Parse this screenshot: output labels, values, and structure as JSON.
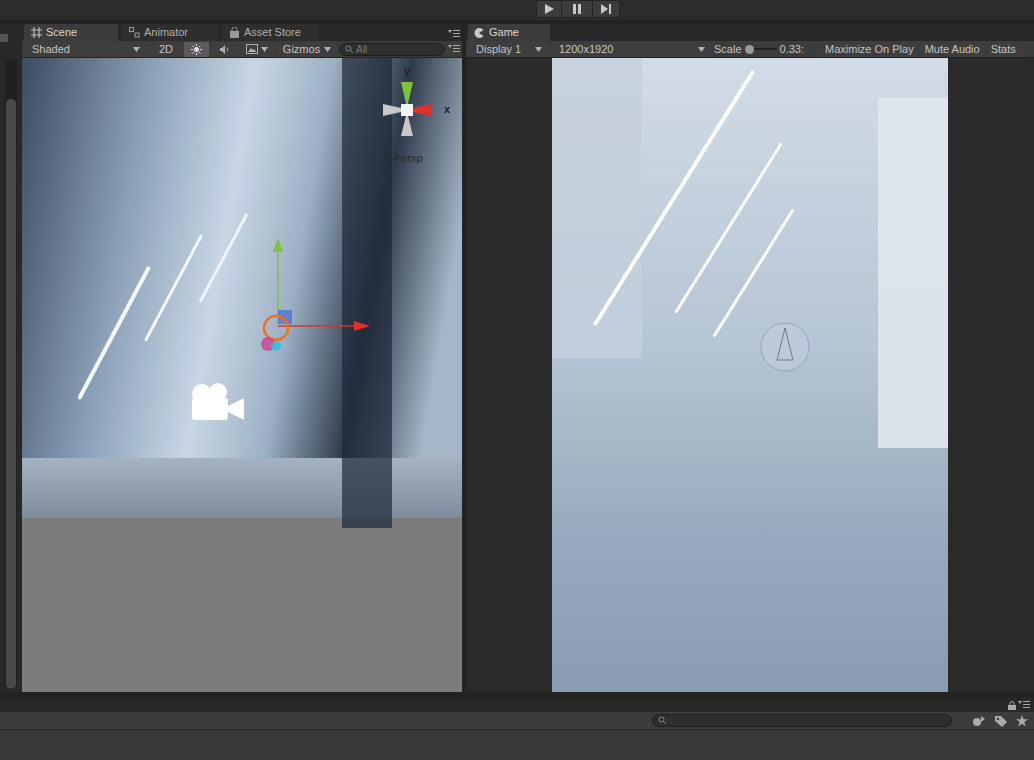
{
  "scene_panel": {
    "tabs": [
      {
        "label": "Scene",
        "selected": true
      },
      {
        "label": "Animator",
        "selected": false
      },
      {
        "label": "Asset Store",
        "selected": false
      }
    ],
    "toolbar": {
      "shading": "Shaded",
      "mode_2d": "2D",
      "mode_2d_on": false,
      "lighting_on": true,
      "audio_on": false,
      "effects_on": false,
      "gizmos": "Gizmos",
      "search_placeholder": "All"
    },
    "orientation_gizmo": {
      "y_label": "y",
      "x_label": "x",
      "projection": "Persp"
    }
  },
  "game_panel": {
    "tabs": [
      {
        "label": "Game",
        "selected": true
      }
    ],
    "toolbar": {
      "display": "Display 1",
      "resolution": "1200x1920",
      "scale_label": "Scale",
      "scale_value": "0.33:",
      "scale_level": 0.0,
      "buttons": [
        {
          "label": "Maximize On Play",
          "on": false
        },
        {
          "label": "Mute Audio",
          "on": false
        },
        {
          "label": "Stats",
          "on": false
        }
      ]
    }
  },
  "bottom_panel": {
    "search_placeholder": ""
  }
}
